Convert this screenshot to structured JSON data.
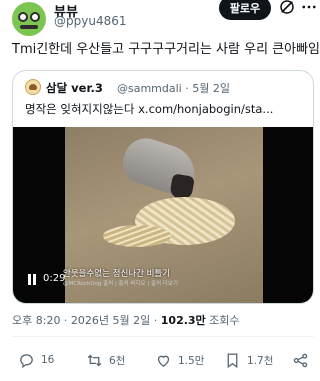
{
  "author": {
    "display_name": "뷰뷰",
    "handle": "@ppyu4861"
  },
  "follow_label": "팔로우",
  "tweet_text": "Tmi긴한데 우산들고 구구구구거리는 사람 우리 큰아빠임",
  "quote": {
    "name": "삼달 ver.3",
    "handle_date": "@sammdali · 5월 2일",
    "text": "명작은 잊혀지지않는다 ",
    "link": "x.com/honjabogin/sta...",
    "video": {
      "subtitle": "안웃을수없는 정신나간 비틀기",
      "watermark": "@MCRockDog 출처 | 출처 비디오 | 출처 더보기",
      "time": "0:29"
    }
  },
  "meta": {
    "time_date": "오후 8:20 · 2026년 5월 2일 · ",
    "views_count": "102.3만",
    "views_label": " 조회수"
  },
  "actions": {
    "reply": "16",
    "retweet": "6천",
    "like": "1.5만",
    "bookmark": "1.7천"
  },
  "colors": {
    "text": "#0f1419",
    "muted": "#536471",
    "border": "#cfd9de",
    "follow_bg": "#0f1419"
  }
}
